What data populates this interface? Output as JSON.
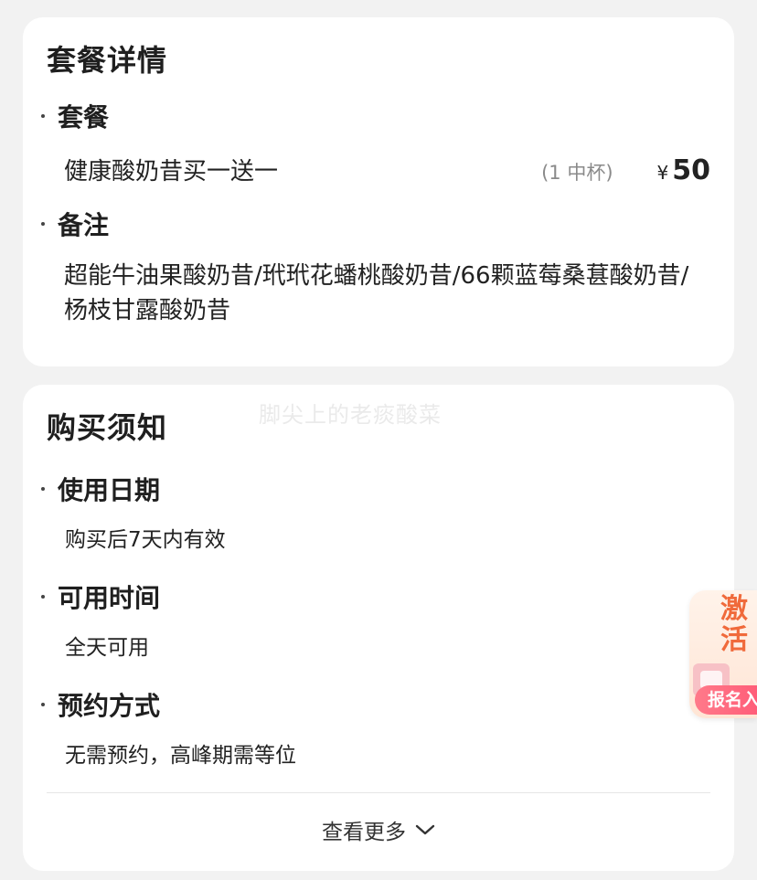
{
  "package_details": {
    "title": "套餐详情",
    "package_label": "套餐",
    "package_name": "健康酸奶昔买一送一",
    "package_size": "(1 中杯)",
    "currency": "¥",
    "price": "50",
    "remark_label": "备注",
    "remark_text": "超能牛油果酸奶昔/玳玳花蟠桃酸奶昔/66颗蓝莓桑葚酸奶昔/杨枝甘露酸奶昔"
  },
  "purchase_notice": {
    "title": "购买须知",
    "items": [
      {
        "label": "使用日期",
        "value": "购买后7天内有效"
      },
      {
        "label": "可用时间",
        "value": "全天可用"
      },
      {
        "label": "预约方式",
        "value": "无需预约，高峰期需等位"
      }
    ],
    "more_label": "查看更多"
  },
  "watermark": "脚尖上的老痰酸菜",
  "floating_badge": {
    "text": "激活",
    "button_label": "报名入"
  }
}
